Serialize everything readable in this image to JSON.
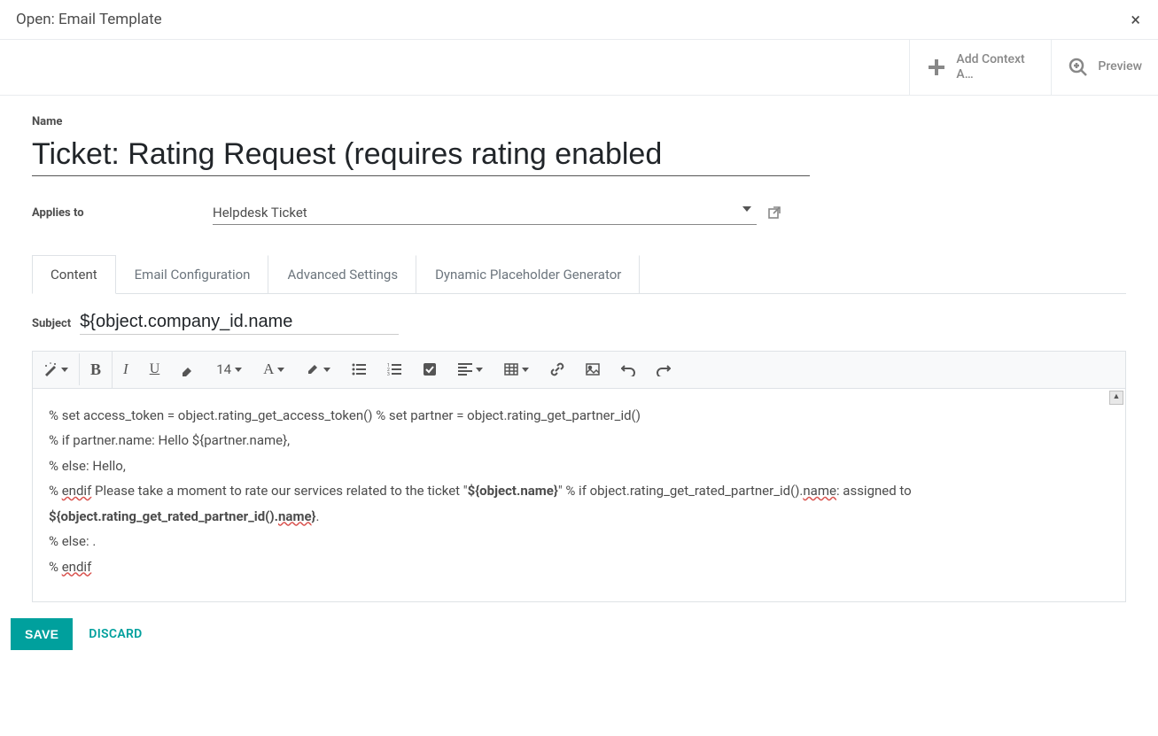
{
  "modal": {
    "title": "Open: Email Template",
    "close": "×"
  },
  "topbar": {
    "add_context_label": "Add Context A…",
    "preview_label": "Preview"
  },
  "form": {
    "name_label": "Name",
    "name_value": "Ticket: Rating Request (requires rating enabled",
    "applies_label": "Applies to",
    "applies_value": "Helpdesk Ticket"
  },
  "tabs": [
    {
      "label": "Content",
      "active": true
    },
    {
      "label": "Email Configuration",
      "active": false
    },
    {
      "label": "Advanced Settings",
      "active": false
    },
    {
      "label": "Dynamic Placeholder Generator",
      "active": false
    }
  ],
  "subject": {
    "label": "Subject",
    "value": "${object.company_id.name"
  },
  "editor_toolbar": {
    "font_size": "14"
  },
  "editor_body": {
    "line1_a": "% set access_token = object.rating_get_access_token() % set partner = object.rating_get_partner_id()",
    "line2_a": "% if partner.name: Hello ${partner.name},",
    "line3_a": "% else: Hello,",
    "line4_a": "% ",
    "line4_spell1": "endif",
    "line4_b": " Please take a moment to rate our services related to the ticket \"",
    "line4_bold1": "${object.name}",
    "line4_c": "\" % if object.rating_get_rated_partner_id().",
    "line4_spell2": "name",
    "line4_d": ": assigned to ",
    "line4_bold2_a": "${object.rating_get_rated_partner_id().",
    "line4_bold2_spell": "name",
    "line4_bold2_b": "}",
    "line4_e": ".",
    "line5_a": "% else: .",
    "line6_a": "% ",
    "line6_spell": "endif"
  },
  "footer": {
    "save": "SAVE",
    "discard": "DISCARD"
  }
}
